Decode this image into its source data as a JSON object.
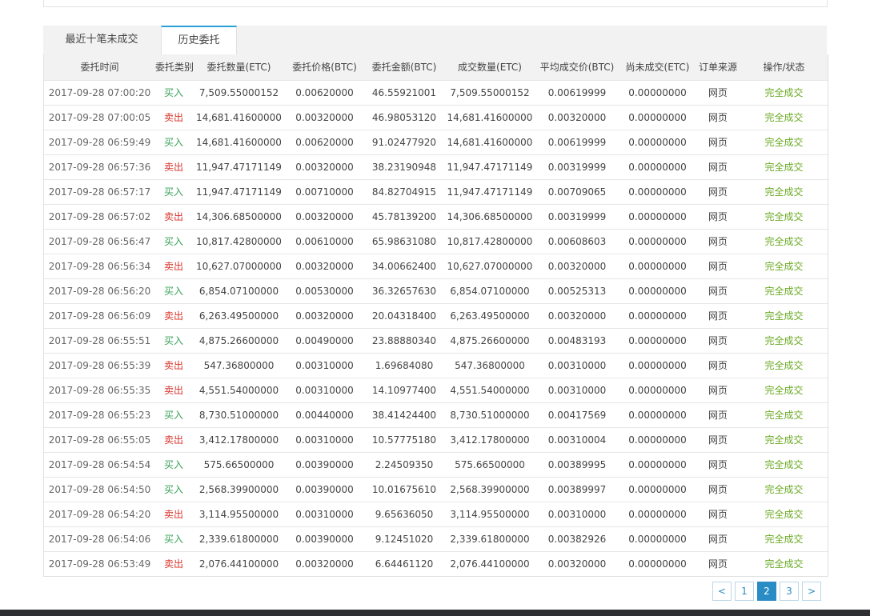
{
  "tabs": [
    {
      "label": "最近十笔未成交"
    },
    {
      "label": "历史委托"
    }
  ],
  "columns": [
    "委托时间",
    "委托类别",
    "委托数量(ETC)",
    "委托价格(BTC)",
    "委托金额(BTC)",
    "成交数量(ETC)",
    "平均成交价(BTC)",
    "尚未成交(ETC)",
    "订单来源",
    "操作/状态"
  ],
  "rows": [
    {
      "time": "2017-09-28 07:00:20",
      "type": "买入",
      "side": "buy",
      "qty": "7,509.55000152",
      "price": "0.00620000",
      "amount": "46.55921001",
      "filled": "7,509.55000152",
      "avg": "0.00619999",
      "remaining": "0.00000000",
      "source": "网页",
      "status": "完全成交"
    },
    {
      "time": "2017-09-28 07:00:05",
      "type": "卖出",
      "side": "sell",
      "qty": "14,681.41600000",
      "price": "0.00320000",
      "amount": "46.98053120",
      "filled": "14,681.41600000",
      "avg": "0.00320000",
      "remaining": "0.00000000",
      "source": "网页",
      "status": "完全成交"
    },
    {
      "time": "2017-09-28 06:59:49",
      "type": "买入",
      "side": "buy",
      "qty": "14,681.41600000",
      "price": "0.00620000",
      "amount": "91.02477920",
      "filled": "14,681.41600000",
      "avg": "0.00619999",
      "remaining": "0.00000000",
      "source": "网页",
      "status": "完全成交"
    },
    {
      "time": "2017-09-28 06:57:36",
      "type": "卖出",
      "side": "sell",
      "qty": "11,947.47171149",
      "price": "0.00320000",
      "amount": "38.23190948",
      "filled": "11,947.47171149",
      "avg": "0.00319999",
      "remaining": "0.00000000",
      "source": "网页",
      "status": "完全成交"
    },
    {
      "time": "2017-09-28 06:57:17",
      "type": "买入",
      "side": "buy",
      "qty": "11,947.47171149",
      "price": "0.00710000",
      "amount": "84.82704915",
      "filled": "11,947.47171149",
      "avg": "0.00709065",
      "remaining": "0.00000000",
      "source": "网页",
      "status": "完全成交"
    },
    {
      "time": "2017-09-28 06:57:02",
      "type": "卖出",
      "side": "sell",
      "qty": "14,306.68500000",
      "price": "0.00320000",
      "amount": "45.78139200",
      "filled": "14,306.68500000",
      "avg": "0.00319999",
      "remaining": "0.00000000",
      "source": "网页",
      "status": "完全成交"
    },
    {
      "time": "2017-09-28 06:56:47",
      "type": "买入",
      "side": "buy",
      "qty": "10,817.42800000",
      "price": "0.00610000",
      "amount": "65.98631080",
      "filled": "10,817.42800000",
      "avg": "0.00608603",
      "remaining": "0.00000000",
      "source": "网页",
      "status": "完全成交"
    },
    {
      "time": "2017-09-28 06:56:34",
      "type": "卖出",
      "side": "sell",
      "qty": "10,627.07000000",
      "price": "0.00320000",
      "amount": "34.00662400",
      "filled": "10,627.07000000",
      "avg": "0.00320000",
      "remaining": "0.00000000",
      "source": "网页",
      "status": "完全成交"
    },
    {
      "time": "2017-09-28 06:56:20",
      "type": "买入",
      "side": "buy",
      "qty": "6,854.07100000",
      "price": "0.00530000",
      "amount": "36.32657630",
      "filled": "6,854.07100000",
      "avg": "0.00525313",
      "remaining": "0.00000000",
      "source": "网页",
      "status": "完全成交"
    },
    {
      "time": "2017-09-28 06:56:09",
      "type": "卖出",
      "side": "sell",
      "qty": "6,263.49500000",
      "price": "0.00320000",
      "amount": "20.04318400",
      "filled": "6,263.49500000",
      "avg": "0.00320000",
      "remaining": "0.00000000",
      "source": "网页",
      "status": "完全成交"
    },
    {
      "time": "2017-09-28 06:55:51",
      "type": "买入",
      "side": "buy",
      "qty": "4,875.26600000",
      "price": "0.00490000",
      "amount": "23.88880340",
      "filled": "4,875.26600000",
      "avg": "0.00483193",
      "remaining": "0.00000000",
      "source": "网页",
      "status": "完全成交"
    },
    {
      "time": "2017-09-28 06:55:39",
      "type": "卖出",
      "side": "sell",
      "qty": "547.36800000",
      "price": "0.00310000",
      "amount": "1.69684080",
      "filled": "547.36800000",
      "avg": "0.00310000",
      "remaining": "0.00000000",
      "source": "网页",
      "status": "完全成交"
    },
    {
      "time": "2017-09-28 06:55:35",
      "type": "卖出",
      "side": "sell",
      "qty": "4,551.54000000",
      "price": "0.00310000",
      "amount": "14.10977400",
      "filled": "4,551.54000000",
      "avg": "0.00310000",
      "remaining": "0.00000000",
      "source": "网页",
      "status": "完全成交"
    },
    {
      "time": "2017-09-28 06:55:23",
      "type": "买入",
      "side": "buy",
      "qty": "8,730.51000000",
      "price": "0.00440000",
      "amount": "38.41424400",
      "filled": "8,730.51000000",
      "avg": "0.00417569",
      "remaining": "0.00000000",
      "source": "网页",
      "status": "完全成交"
    },
    {
      "time": "2017-09-28 06:55:05",
      "type": "卖出",
      "side": "sell",
      "qty": "3,412.17800000",
      "price": "0.00310000",
      "amount": "10.57775180",
      "filled": "3,412.17800000",
      "avg": "0.00310004",
      "remaining": "0.00000000",
      "source": "网页",
      "status": "完全成交"
    },
    {
      "time": "2017-09-28 06:54:54",
      "type": "买入",
      "side": "buy",
      "qty": "575.66500000",
      "price": "0.00390000",
      "amount": "2.24509350",
      "filled": "575.66500000",
      "avg": "0.00389995",
      "remaining": "0.00000000",
      "source": "网页",
      "status": "完全成交"
    },
    {
      "time": "2017-09-28 06:54:50",
      "type": "买入",
      "side": "buy",
      "qty": "2,568.39900000",
      "price": "0.00390000",
      "amount": "10.01675610",
      "filled": "2,568.39900000",
      "avg": "0.00389997",
      "remaining": "0.00000000",
      "source": "网页",
      "status": "完全成交"
    },
    {
      "time": "2017-09-28 06:54:20",
      "type": "卖出",
      "side": "sell",
      "qty": "3,114.95500000",
      "price": "0.00310000",
      "amount": "9.65636050",
      "filled": "3,114.95500000",
      "avg": "0.00310000",
      "remaining": "0.00000000",
      "source": "网页",
      "status": "完全成交"
    },
    {
      "time": "2017-09-28 06:54:06",
      "type": "买入",
      "side": "buy",
      "qty": "2,339.61800000",
      "price": "0.00390000",
      "amount": "9.12451020",
      "filled": "2,339.61800000",
      "avg": "0.00382926",
      "remaining": "0.00000000",
      "source": "网页",
      "status": "完全成交"
    },
    {
      "time": "2017-09-28 06:53:49",
      "type": "卖出",
      "side": "sell",
      "qty": "2,076.44100000",
      "price": "0.00320000",
      "amount": "6.64461120",
      "filled": "2,076.44100000",
      "avg": "0.00320000",
      "remaining": "0.00000000",
      "source": "网页",
      "status": "完全成交"
    }
  ],
  "pagination": {
    "prev": "<",
    "pages": [
      "1",
      "2",
      "3"
    ],
    "current": "2",
    "next": ">"
  },
  "colors": {
    "buy": "#3aa15a",
    "sell": "#d9322b",
    "status": "#6aaa22",
    "accent": "#2a8cc4",
    "tab_active_border": "#2aa0d8",
    "footer": "#2d2f33"
  }
}
